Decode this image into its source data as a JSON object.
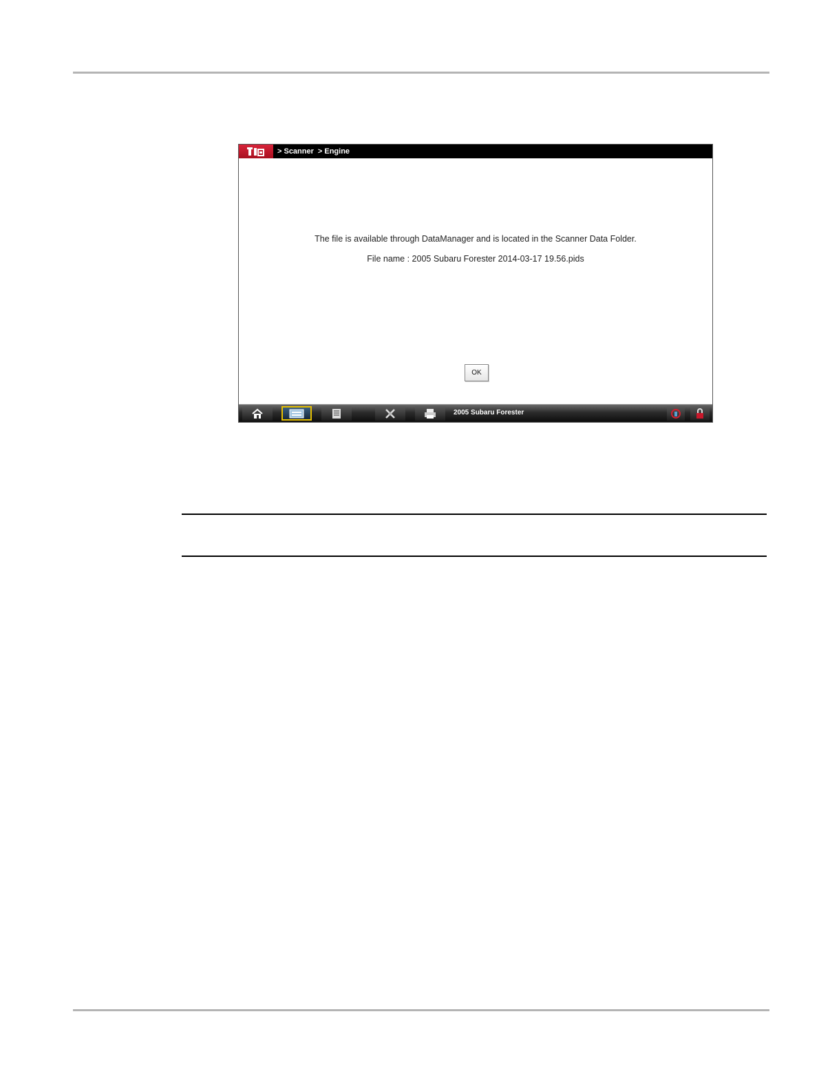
{
  "breadcrumb": {
    "items": [
      "> Scanner",
      "> Engine"
    ]
  },
  "dialog": {
    "line1": "The file is available through DataManager and is located in the Scanner Data Folder.",
    "line2": "File name : 2005 Subaru Forester 2014-03-17 19.56.pids",
    "ok_label": "OK"
  },
  "toolbar": {
    "vehicle_label": "2005 Subaru Forester",
    "buttons": [
      "home-icon",
      "data-icon",
      "list-icon",
      "tools-icon",
      "printer-icon"
    ],
    "status_icons": [
      "connection-icon",
      "lock-icon"
    ]
  },
  "colors": {
    "title_bar": "#000000",
    "logo_red": "#c8182b",
    "active_border": "#e8c000"
  }
}
